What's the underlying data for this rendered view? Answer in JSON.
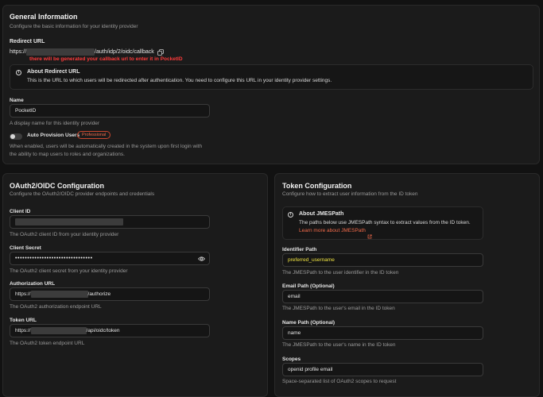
{
  "general": {
    "title": "General Information",
    "description": "Configure the basic information for your identity provider",
    "redirect_label": "Redirect URL",
    "redirect_prefix": "https://",
    "redirect_suffix": "/auth/idp/2/oidc/callback",
    "annotation": "there will be generated your callback url to enter it in PocketID",
    "about_title": "About Redirect URL",
    "about_text": "This is the URL to which users will be redirected after authentication. You need to configure this URL in your identity provider settings.",
    "name_label": "Name",
    "name_value": "PocketID",
    "name_help": "A display name for this identity provider",
    "auto_provision_label": "Auto Provision Users",
    "badge": "Professional",
    "auto_provision_help_1": "When enabled, users will be automatically created in the system upon first login with",
    "auto_provision_help_2": "the ability to map users to roles and organizations."
  },
  "oauth": {
    "title": "OAuth2/OIDC Configuration",
    "description": "Configure the OAuth2/OIDC provider endpoints and credentials",
    "client_id_label": "Client ID",
    "client_id_help": "The OAuth2 client ID from your identity provider",
    "client_secret_label": "Client Secret",
    "client_secret_value": "••••••••••••••••••••••••••••••••",
    "client_secret_help": "The OAuth2 client secret from your identity provider",
    "auth_url_label": "Authorization URL",
    "auth_url_prefix": "https://",
    "auth_url_suffix": "/authorize",
    "auth_url_help": "The OAuth2 authorization endpoint URL",
    "token_url_label": "Token URL",
    "token_url_prefix": "https://",
    "token_url_suffix": "/api/oidc/token",
    "token_url_help": "The OAuth2 token endpoint URL"
  },
  "token": {
    "title": "Token Configuration",
    "description": "Configure how to extract user information from the ID token",
    "about_title": "About JMESPath",
    "about_text": "The paths below use JMESPath syntax to extract values from the ID token.",
    "about_link": "Learn more about JMESPath",
    "identifier_label": "Identifier Path",
    "identifier_value": "preferred_username",
    "identifier_help": "The JMESPath to the user identifier in the ID token",
    "email_label": "Email Path (Optional)",
    "email_value": "email",
    "email_help": "The JMESPath to the user's email in the ID token",
    "name_label": "Name Path (Optional)",
    "name_value": "name",
    "name_help": "The JMESPath to the user's name in the ID token",
    "scopes_label": "Scopes",
    "scopes_value": "openid profile email",
    "scopes_help": "Space-separated list of OAuth2 scopes to request"
  },
  "colors": {
    "background": "#121212",
    "card": "#1b1b1b",
    "accent": "#f06a4a",
    "annotation": "#ff3a3a",
    "highlight": "#f0e442"
  }
}
